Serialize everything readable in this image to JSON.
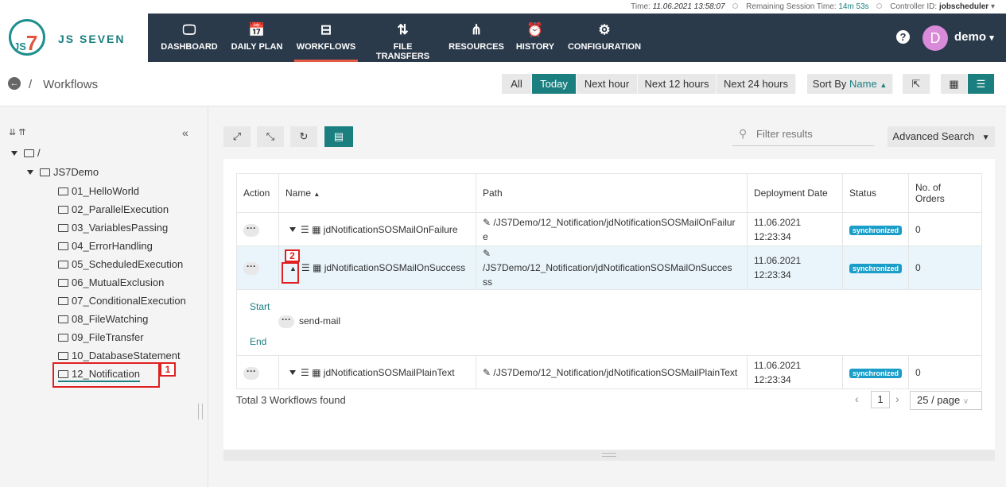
{
  "status_bar": {
    "time_label": "Time:",
    "time": "11.06.2021 13:58:07",
    "session_label": "Remaining Session Time:",
    "session": "14m 53s",
    "controller_label": "Controller ID:",
    "controller": "jobscheduler"
  },
  "logo": {
    "mark": "JS",
    "mark7": "7",
    "text": "JS SEVEN"
  },
  "nav": [
    {
      "label": "DASHBOARD",
      "icon": "monitor-icon",
      "glyph": "🖵"
    },
    {
      "label": "DAILY PLAN",
      "icon": "calendar-icon",
      "glyph": "📅"
    },
    {
      "label": "WORKFLOWS",
      "icon": "workflow-icon",
      "glyph": "⊟"
    },
    {
      "label": "FILE TRANSFERS",
      "icon": "transfer-arrows-icon",
      "glyph": "⇅"
    },
    {
      "label": "RESOURCES",
      "icon": "share-icon",
      "glyph": "⋔"
    },
    {
      "label": "HISTORY",
      "icon": "alarm-clock-icon",
      "glyph": "⏰"
    },
    {
      "label": "CONFIGURATION",
      "icon": "gears-icon",
      "glyph": "⚙"
    }
  ],
  "user": {
    "help": "?",
    "initial": "D",
    "name": "demo"
  },
  "breadcrumb": {
    "slash": "/",
    "title": "Workflows"
  },
  "filters": [
    "All",
    "Today",
    "Next hour",
    "Next 12 hours",
    "Next 24 hours"
  ],
  "sort": {
    "label": "Sort By",
    "value": "Name"
  },
  "toolbar": {
    "search_placeholder": "Filter results",
    "advanced_search": "Advanced Search"
  },
  "tree": [
    {
      "label": "/",
      "level": 0
    },
    {
      "label": "JS7Demo",
      "level": 1
    },
    {
      "label": "01_HelloWorld",
      "level": 2
    },
    {
      "label": "02_ParallelExecution",
      "level": 2
    },
    {
      "label": "03_VariablesPassing",
      "level": 2
    },
    {
      "label": "04_ErrorHandling",
      "level": 2
    },
    {
      "label": "05_ScheduledExecution",
      "level": 2
    },
    {
      "label": "06_MutualExclusion",
      "level": 2
    },
    {
      "label": "07_ConditionalExecution",
      "level": 2
    },
    {
      "label": "08_FileWatching",
      "level": 2
    },
    {
      "label": "09_FileTransfer",
      "level": 2
    },
    {
      "label": "10_DatabaseStatement",
      "level": 2
    },
    {
      "label": "12_Notification",
      "level": 2
    }
  ],
  "table": {
    "headers": {
      "action": "Action",
      "name": "Name",
      "path": "Path",
      "deploy": "Deployment Date",
      "status": "Status",
      "orders1": "No. of",
      "orders2": "Orders"
    },
    "rows": [
      {
        "name": "jdNotificationSOSMailOnFailure",
        "path1": "/JS7Demo/12_Notification/jdNotificationSOSMailOnFailur",
        "path2": "e",
        "date": "11.06.2021",
        "time": "12:23:34",
        "status": "synchronized",
        "orders": "0"
      },
      {
        "name": "jdNotificationSOSMailOnSuccess",
        "path1": "/JS7Demo/12_Notification/jdNotificationSOSMailOnSucces",
        "path2": "ss",
        "date": "11.06.2021",
        "time": "12:23:34",
        "status": "synchronized",
        "orders": "0"
      },
      {
        "name": "jdNotificationSOSMailPlainText",
        "path1": "/JS7Demo/12_Notification/jdNotificationSOSMailPlainText",
        "path2": "",
        "date": "11.06.2021",
        "time": "12:23:34",
        "status": "synchronized",
        "orders": "0"
      }
    ],
    "expanded": {
      "start": "Start",
      "step": "send-mail",
      "end": "End"
    }
  },
  "footer": {
    "total": "Total 3 Workflows found",
    "page": "1",
    "per_page": "25 / page"
  },
  "annotations": [
    "1",
    "2"
  ]
}
